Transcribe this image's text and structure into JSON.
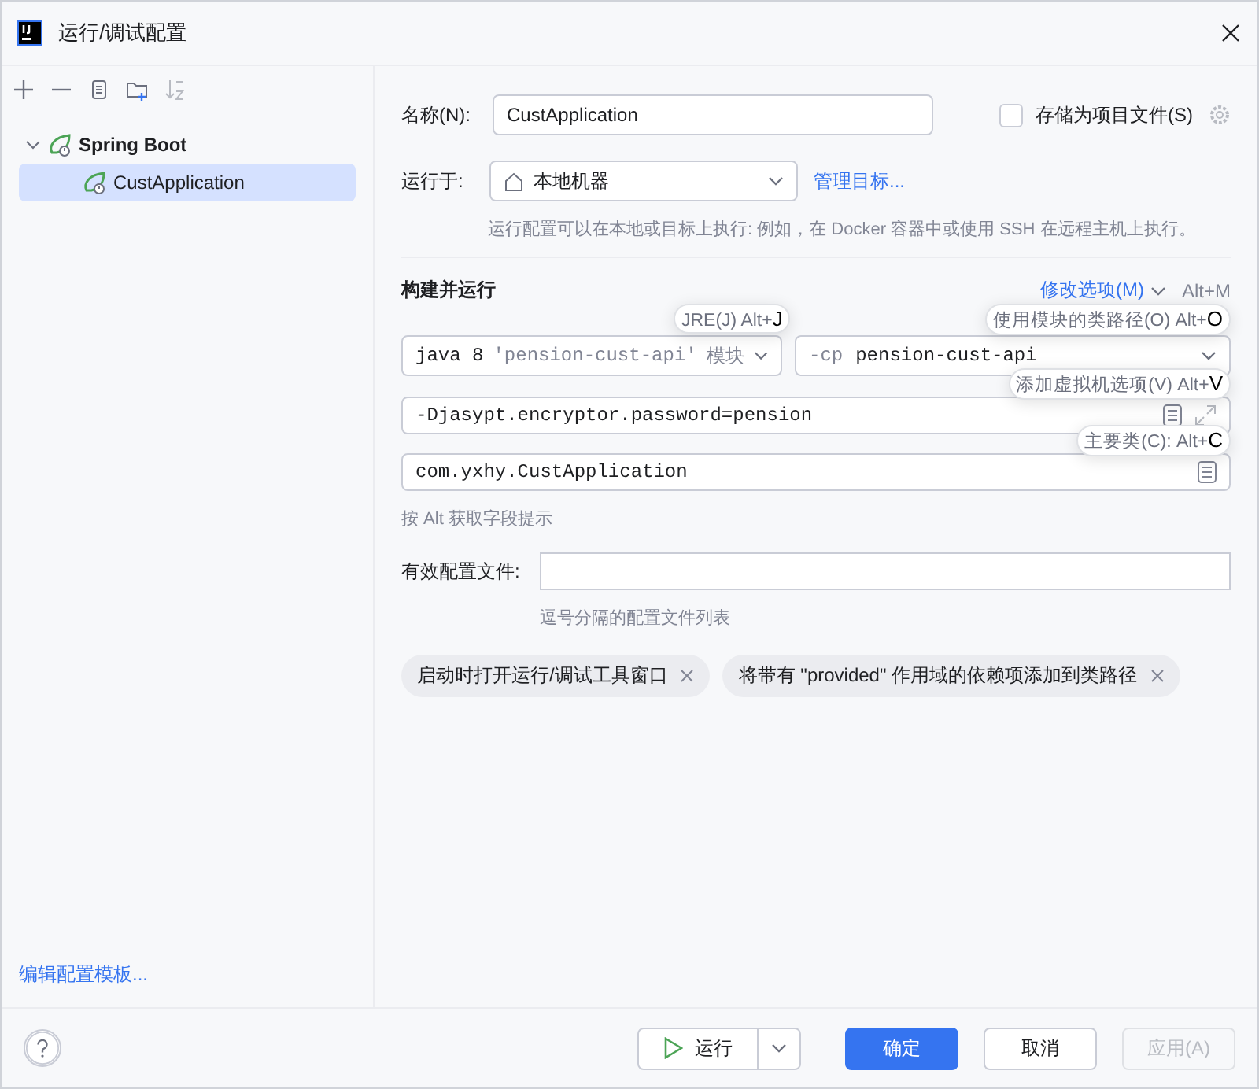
{
  "window": {
    "title": "运行/调试配置"
  },
  "toolbar": [
    {
      "kind": "add",
      "disabled": false
    },
    {
      "kind": "remove",
      "disabled": false
    },
    {
      "kind": "copy",
      "disabled": false
    },
    {
      "kind": "folder",
      "disabled": false
    },
    {
      "kind": "sort",
      "disabled": true
    }
  ],
  "tree": [
    {
      "label": "Spring Boot",
      "expanded": true,
      "selected": false,
      "children": [
        {
          "label": "CustApplication",
          "selected": true
        }
      ]
    }
  ],
  "edit_templates_link": "编辑配置模板...",
  "name": {
    "label": "名称(N):",
    "value": "CustApplication"
  },
  "store_as_project_file": {
    "label": "存储为项目文件(S)",
    "checked": false
  },
  "run_on": {
    "label": "运行于:",
    "value": "本地机器",
    "link": "管理目标...",
    "hint": "运行配置可以在本地或目标上执行: 例如，在 Docker 容器中或使用 SSH 在远程主机上执行。"
  },
  "build_and_run": {
    "title": "构建并运行",
    "modify_options": "修改选项(M)",
    "shortcut": "Alt+M",
    "jre": {
      "version": "java 8",
      "module": "'pension-cust-api'",
      "suffix": "模块"
    },
    "classpath": {
      "flag": "-cp",
      "module": "pension-cust-api"
    },
    "vm_options": "-Djasypt.encryptor.password=pension",
    "main_class": "com.yxhy.CustApplication",
    "hint": "按 Alt 获取字段提示"
  },
  "tooltips": [
    "JRE(J) Alt+**J**",
    "使用模块的类路径(O) Alt+**O**",
    "添加虚拟机选项(V) Alt+**V**",
    "主要类(C): Alt+**C**"
  ],
  "active_profiles": {
    "label": "有效配置文件:",
    "hint": "逗号分隔的配置文件列表"
  },
  "option_chips": [
    "启动时打开运行/调试工具窗口",
    "将带有 \"provided\" 作用域的依赖项添加到类路径"
  ],
  "buttons": [
    {
      "kind": "run",
      "label": "运行",
      "disabled": false
    },
    {
      "kind": "primary",
      "label": "确定",
      "disabled": false
    },
    {
      "kind": "normal",
      "label": "取消",
      "disabled": false
    },
    {
      "kind": "normal",
      "label": "应用(A)",
      "disabled": true
    }
  ]
}
